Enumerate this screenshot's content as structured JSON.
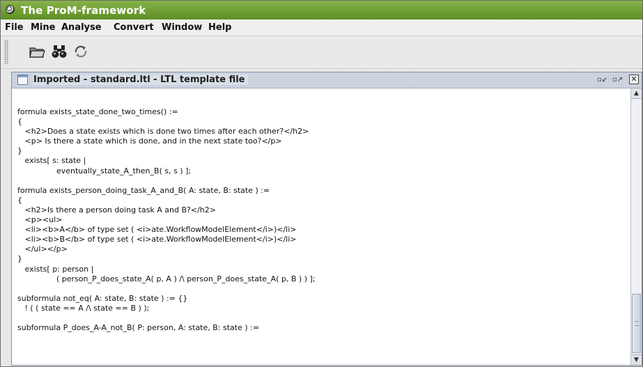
{
  "window": {
    "title": "The ProM-framework"
  },
  "menubar": {
    "items": [
      "File",
      "Mine",
      "Analyse",
      "Convert",
      "Window",
      "Help"
    ]
  },
  "toolbar": {
    "buttons": [
      {
        "icon": "open-folder-icon"
      },
      {
        "icon": "binoculars-icon"
      },
      {
        "icon": "refresh-icon"
      }
    ]
  },
  "internal_frame": {
    "title": "Imported - standard.ltl - LTL template file",
    "controls": [
      "restore-icon",
      "maximize-icon",
      "close-icon"
    ]
  },
  "editor": {
    "lines": [
      "formula exists_state_done_two_times() :=",
      "{",
      "   <h2>Does a state exists which is done two times after each other?</h2>",
      "   <p> Is there a state which is done, and in the next state too?</p>",
      "}",
      "   exists[ s: state |",
      "                eventually_state_A_then_B( s, s ) ];",
      "",
      "formula exists_person_doing_task_A_and_B( A: state, B: state ) :=",
      "{",
      "   <h2>Is there a person doing task A and B?</h2>",
      "   <p><ul>",
      "   <li><b>A</b> of type set ( <i>ate.WorkflowModelElement</i>)</li>",
      "   <li><b>B</b> of type set ( <i>ate.WorkflowModelElement</i>)</li>",
      "   </ul></p>",
      "}",
      "   exists[ p: person |",
      "                ( person_P_does_state_A( p, A ) /\\ person_P_does_state_A( p, B ) ) ];",
      "",
      "subformula not_eq( A: state, B: state ) := {}",
      "   ! ( ( state == A /\\ state == B ) );",
      "",
      "subformula P_does_A-A_not_B( P: person, A: state, B: state ) :="
    ]
  },
  "colors": {
    "title_bar": "#6f9e31",
    "frame_border": "#7f8fa8",
    "frame_title_bg": "#d9dfe8"
  }
}
